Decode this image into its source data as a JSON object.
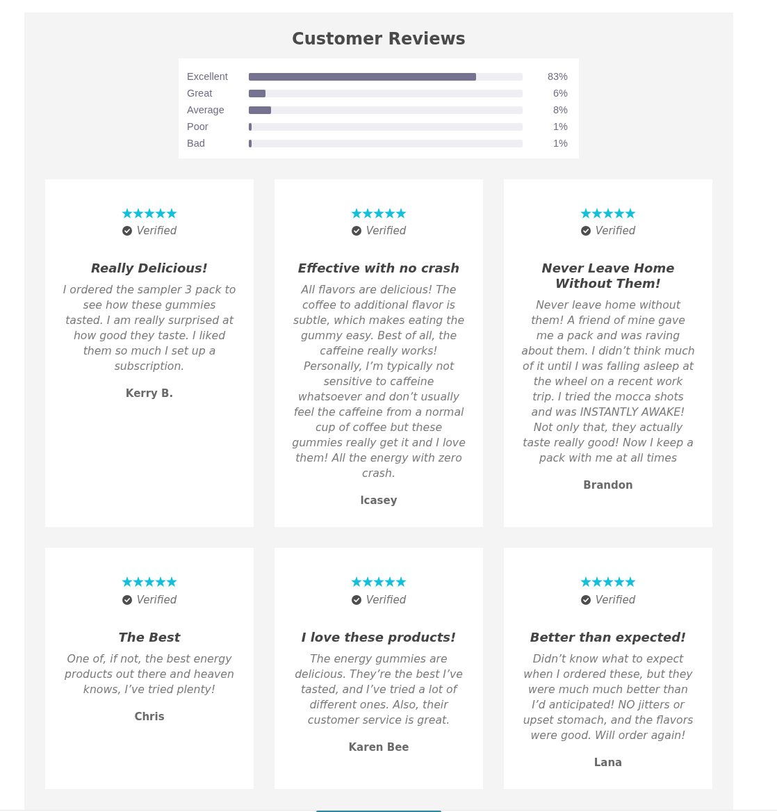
{
  "heading": "Customer Reviews",
  "rating_breakdown": [
    {
      "label": "Excellent",
      "level": 0.83,
      "reading": "83%"
    },
    {
      "label": "Great",
      "level": 0.06,
      "reading": "6%"
    },
    {
      "label": "Average",
      "level": 0.08,
      "reading": "8%"
    },
    {
      "label": "Poor",
      "level": 0.01,
      "reading": "1%"
    },
    {
      "label": "Bad",
      "level": 0.01,
      "reading": "1%"
    }
  ],
  "reviews": [
    {
      "stars": 5,
      "verified": true,
      "verified_label": "Verified",
      "title": "Really Delicious!",
      "body": "I ordered the sampler 3 pack to see how these gummies tasted. I am really surprised at how good they taste. I liked them so much I set up a subscription.",
      "author": "Kerry B."
    },
    {
      "stars": 5,
      "verified": true,
      "verified_label": "Verified",
      "title": "Effective with no crash",
      "body": "All flavors are delicious! The coffee to additional flavor is subtle, which makes eating the gummy easy. Best of all, the caffeine really works! Personally, I’m typically not sensitive to caffeine whatsoever and don’t usually feel the caffeine from a normal cup of coffee but these gummies really get it and I love them! All the energy with zero crash.",
      "author": "lcasey"
    },
    {
      "stars": 5,
      "verified": true,
      "verified_label": "Verified",
      "title": "Never Leave Home Without Them!",
      "body": "Never leave home without them! A friend of mine gave me a pack and was raving about them. I didn’t think much of it until I was falling asleep at the wheel on a recent work trip. I tried the mocca shots and was INSTANTLY AWAKE! Not only that, they actually taste really good! Now I keep a pack with me at all times",
      "author": "Brandon"
    },
    {
      "stars": 5,
      "verified": true,
      "verified_label": "Verified",
      "title": "The Best",
      "body": "One of, if not, the best energy products out there and heaven knows, I’ve tried plenty!",
      "author": "Chris"
    },
    {
      "stars": 5,
      "verified": true,
      "verified_label": "Verified",
      "title": "I love these products!",
      "body": "The energy gummies are delicious. They’re the best I’ve tasted, and I’ve tried a lot of different ones. Also, their customer service is great.",
      "author": "Karen Bee"
    },
    {
      "stars": 5,
      "verified": true,
      "verified_label": "Verified",
      "title": "Better than expected!",
      "body": "Didn’t know what to expect when I ordered these, but they were much much better than I’d anticipated! NO jitters or upset stomach, and the flavors were good. Will order again!",
      "author": "Lana"
    }
  ]
}
